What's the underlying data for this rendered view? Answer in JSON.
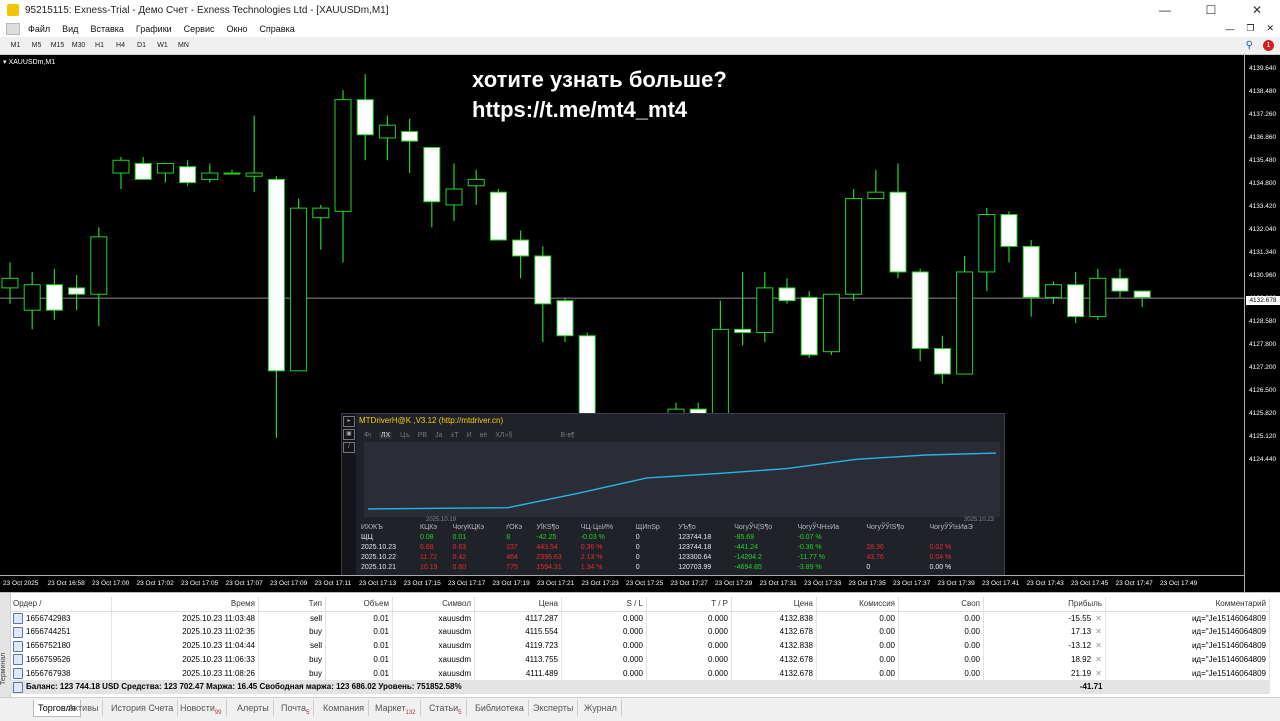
{
  "window": {
    "title": "95215115: Exness-Trial - Демо Счет - Exness Technologies Ltd - [XAUUSDm,M1]",
    "minimize_icon": "minimize-icon",
    "maximize_icon": "maximize-icon",
    "close_icon": "close-icon"
  },
  "menu": {
    "items": [
      "Файл",
      "Вид",
      "Вставка",
      "Графики",
      "Сервис",
      "Окно",
      "Справка"
    ]
  },
  "toolbar": {
    "timeframes": [
      "M1",
      "M5",
      "M15",
      "M30",
      "H1",
      "H4",
      "D1",
      "W1",
      "MN"
    ],
    "notification_count": "1"
  },
  "chart": {
    "tab_label": "XAUUSDm,M1",
    "watermark_line1": "хотите узнать больше?",
    "watermark_line2": "https://t.me/mt4_mt4",
    "current_price": "4132.678",
    "colors": {
      "background": "#000000",
      "candle_border": "#22d422",
      "candle_bull": "#000000",
      "candle_bear": "#ffffff"
    }
  },
  "chart_data": {
    "type": "candlestick",
    "symbol": "XAUUSDm",
    "timeframe": "M1",
    "y_ticks": [
      "4139.640",
      "4138.480",
      "4137.260",
      "4136.860",
      "4135.480",
      "4134.800",
      "4133.420",
      "4132.040",
      "4131.340",
      "4130.960",
      "4129.960",
      "4128.580",
      "4127.800",
      "4127.200",
      "4126.500",
      "4125.820",
      "4125.120",
      "4124.440"
    ],
    "x_ticks": [
      "23 Oct 2025",
      "23 Oct 16:58",
      "23 Oct 17:00",
      "23 Oct 17:02",
      "23 Oct 17:05",
      "23 Oct 17:07",
      "23 Oct 17:09",
      "23 Oct 17:11",
      "23 Oct 17:13",
      "23 Oct 17:15",
      "23 Oct 17:17",
      "23 Oct 17:19",
      "23 Oct 17:21",
      "23 Oct 17:23",
      "23 Oct 17:25",
      "23 Oct 17:27",
      "23 Oct 17:29",
      "23 Oct 17:31",
      "23 Oct 17:33",
      "23 Oct 17:35",
      "23 Oct 17:37",
      "23 Oct 17:39",
      "23 Oct 17:41",
      "23 Oct 17:43",
      "23 Oct 17:45",
      "23 Oct 17:47",
      "23 Oct 17:49"
    ],
    "candles": [
      {
        "o": 4133.0,
        "h": 4133.8,
        "l": 4132.5,
        "c": 4133.3
      },
      {
        "o": 4132.3,
        "h": 4133.5,
        "l": 4131.7,
        "c": 4133.1
      },
      {
        "o": 4133.1,
        "h": 4133.6,
        "l": 4132.0,
        "c": 4132.3
      },
      {
        "o": 4133.0,
        "h": 4133.4,
        "l": 4132.3,
        "c": 4132.8
      },
      {
        "o": 4132.8,
        "h": 4134.9,
        "l": 4131.8,
        "c": 4134.6
      },
      {
        "o": 4136.6,
        "h": 4137.1,
        "l": 4136.1,
        "c": 4137.0
      },
      {
        "o": 4136.9,
        "h": 4137.1,
        "l": 4136.4,
        "c": 4136.4
      },
      {
        "o": 4136.6,
        "h": 4136.9,
        "l": 4136.3,
        "c": 4136.9
      },
      {
        "o": 4136.8,
        "h": 4137.0,
        "l": 4136.2,
        "c": 4136.3
      },
      {
        "o": 4136.4,
        "h": 4136.9,
        "l": 4136.3,
        "c": 4136.6
      },
      {
        "o": 4136.6,
        "h": 4136.7,
        "l": 4136.6,
        "c": 4136.6
      },
      {
        "o": 4136.5,
        "h": 4138.4,
        "l": 4136.0,
        "c": 4136.6
      },
      {
        "o": 4136.4,
        "h": 4136.5,
        "l": 4128.3,
        "c": 4130.4
      },
      {
        "o": 4130.4,
        "h": 4135.8,
        "l": 4130.4,
        "c": 4135.5
      },
      {
        "o": 4135.2,
        "h": 4135.6,
        "l": 4134.2,
        "c": 4135.5
      },
      {
        "o": 4135.4,
        "h": 4139.2,
        "l": 4133.8,
        "c": 4138.9
      },
      {
        "o": 4138.9,
        "h": 4139.7,
        "l": 4137.0,
        "c": 4137.8
      },
      {
        "o": 4137.7,
        "h": 4138.4,
        "l": 4137.0,
        "c": 4138.1
      },
      {
        "o": 4137.9,
        "h": 4138.3,
        "l": 4136.6,
        "c": 4137.6
      },
      {
        "o": 4137.4,
        "h": 4137.4,
        "l": 4134.9,
        "c": 4135.7
      },
      {
        "o": 4135.6,
        "h": 4136.9,
        "l": 4135.1,
        "c": 4136.1
      },
      {
        "o": 4136.2,
        "h": 4136.7,
        "l": 4135.6,
        "c": 4136.4
      },
      {
        "o": 4136.0,
        "h": 4136.1,
        "l": 4134.5,
        "c": 4134.5
      },
      {
        "o": 4134.5,
        "h": 4134.8,
        "l": 4133.3,
        "c": 4134.0
      },
      {
        "o": 4134.0,
        "h": 4134.3,
        "l": 4131.3,
        "c": 4132.5
      },
      {
        "o": 4132.6,
        "h": 4132.7,
        "l": 4131.3,
        "c": 4131.5
      },
      {
        "o": 4131.5,
        "h": 4131.6,
        "l": 4127.8,
        "c": 4128.6
      },
      {
        "o": 4128.6,
        "h": 4128.7,
        "l": 4128.4,
        "c": 4128.6
      },
      {
        "o": 4128.6,
        "h": 4128.7,
        "l": 4128.4,
        "c": 4128.6
      },
      {
        "o": 4128.6,
        "h": 4128.8,
        "l": 4128.5,
        "c": 4128.7
      },
      {
        "o": 4128.7,
        "h": 4129.4,
        "l": 4128.4,
        "c": 4129.2
      },
      {
        "o": 4129.2,
        "h": 4129.4,
        "l": 4128.5,
        "c": 4128.7
      },
      {
        "o": 4128.5,
        "h": 4132.6,
        "l": 4128.3,
        "c": 4131.7
      },
      {
        "o": 4131.7,
        "h": 4133.5,
        "l": 4131.2,
        "c": 4131.6
      },
      {
        "o": 4131.6,
        "h": 4133.5,
        "l": 4131.3,
        "c": 4133.0
      },
      {
        "o": 4133.0,
        "h": 4133.3,
        "l": 4132.5,
        "c": 4132.6
      },
      {
        "o": 4132.7,
        "h": 4132.9,
        "l": 4130.8,
        "c": 4130.9
      },
      {
        "o": 4131.0,
        "h": 4132.8,
        "l": 4130.9,
        "c": 4132.8
      },
      {
        "o": 4132.8,
        "h": 4136.1,
        "l": 4132.6,
        "c": 4135.8
      },
      {
        "o": 4135.8,
        "h": 4136.7,
        "l": 4135.8,
        "c": 4136.0
      },
      {
        "o": 4136.0,
        "h": 4136.9,
        "l": 4133.3,
        "c": 4133.5
      },
      {
        "o": 4133.5,
        "h": 4133.6,
        "l": 4130.7,
        "c": 4131.1
      },
      {
        "o": 4131.1,
        "h": 4131.5,
        "l": 4130.0,
        "c": 4130.3
      },
      {
        "o": 4130.3,
        "h": 4134.0,
        "l": 4130.3,
        "c": 4133.5
      },
      {
        "o": 4133.5,
        "h": 4135.5,
        "l": 4132.9,
        "c": 4135.3
      },
      {
        "o": 4135.3,
        "h": 4135.4,
        "l": 4133.8,
        "c": 4134.3
      },
      {
        "o": 4134.3,
        "h": 4134.5,
        "l": 4132.1,
        "c": 4132.7
      },
      {
        "o": 4132.7,
        "h": 4133.2,
        "l": 4132.5,
        "c": 4133.1
      },
      {
        "o": 4133.1,
        "h": 4133.5,
        "l": 4131.9,
        "c": 4132.1
      },
      {
        "o": 4132.1,
        "h": 4133.6,
        "l": 4132.0,
        "c": 4133.3
      },
      {
        "o": 4133.3,
        "h": 4133.6,
        "l": 4132.7,
        "c": 4132.9
      },
      {
        "o": 4132.9,
        "h": 4132.9,
        "l": 4132.4,
        "c": 4132.7
      }
    ]
  },
  "ea_panel": {
    "title": "MTDriverH@K ,V3.12 (http://mtdriver.cn)",
    "tabs": [
      "Фі",
      "ЛХ",
      "Цъ",
      "РВ",
      "Ја",
      "±Т",
      "И",
      "вё",
      "ХЛ»§",
      "В-в¶"
    ],
    "active_tab": "ЛХ",
    "graph_start_label": "2025.10.19",
    "graph_end_label": "2025.10.23",
    "equity_curve": [
      0.05,
      0.06,
      0.07,
      0.3,
      0.55,
      0.62,
      0.7,
      0.85,
      0.92,
      0.95
    ],
    "headers": [
      "ИХЖЪ",
      "КЦКэ",
      "ЧогуКЦКэ",
      "ґОКэ",
      "УЇКЅ¶о",
      "ЧЦ·Ц±И%",
      "ЩИnЅр",
      "УЪ¶о",
      "ЧогуЎЧ¦Ѕ¶о",
      "ЧогуЎЧН±Иа",
      "ЧогуЎЎїЅ¶о",
      "ЧогуЎЎї±ИаЭ"
    ],
    "rows": [
      {
        "date": "ЩЦ",
        "c1": "0.08",
        "c2": "0.01",
        "c3": "8",
        "c4": "-42.25",
        "c5": "-0.03 %",
        "c6": "0",
        "c7": "123744.18",
        "c8": "-85.69",
        "c9": "-0.07 %",
        "c10": "",
        "c11": "",
        "tone": "green"
      },
      {
        "date": "2025.10.23",
        "c1": "6.68",
        "c2": "0.63",
        "c3": "237",
        "c4": "443.54",
        "c5": "0.36 %",
        "c6": "0",
        "c7": "123744.18",
        "c8": "-441.24",
        "c9": "-0.36 %",
        "c10": "28.36",
        "c11": "0.02 %",
        "tone": "red"
      },
      {
        "date": "2025.10.22",
        "c1": "11.72",
        "c2": "0.42",
        "c3": "464",
        "c4": "2396.63",
        "c5": "2.13 %",
        "c6": "0",
        "c7": "123300.64",
        "c8": "-14204.2",
        "c9": "-11.77 %",
        "c10": "43.76",
        "c11": "0.04 %",
        "tone": "red"
      },
      {
        "date": "2025.10.21",
        "c1": "10.19",
        "c2": "0.60",
        "c3": "775",
        "c4": "1594.31",
        "c5": "1.34 %",
        "c6": "0",
        "c7": "120703.99",
        "c8": "-4694.85",
        "c9": "-3.89 %",
        "c10": "0",
        "c11": "0.00 %",
        "tone": "red"
      }
    ]
  },
  "terminal": {
    "side_label": "Терминал",
    "columns": [
      "Ордер",
      "/",
      "Время",
      "Тип",
      "Объем",
      "Символ",
      "Цена",
      "S / L",
      "T / P",
      "Цена",
      "Комиссия",
      "Своп",
      "Прибыль",
      "Комментарий"
    ],
    "orders": [
      {
        "id": "1656742983",
        "time": "2025.10.23 11:03:48",
        "type": "sell",
        "volume": "0.01",
        "symbol": "xauusdm",
        "open_price": "4117.287",
        "sl": "0.000",
        "tp": "0.000",
        "price": "4132.838",
        "commission": "0.00",
        "swap": "0.00",
        "profit": "-15.55",
        "comment": "ид=\"Je15146064809"
      },
      {
        "id": "1656744251",
        "time": "2025.10.23 11:02:35",
        "type": "buy",
        "volume": "0.01",
        "symbol": "xauusdm",
        "open_price": "4115.554",
        "sl": "0.000",
        "tp": "0.000",
        "price": "4132.678",
        "commission": "0.00",
        "swap": "0.00",
        "profit": "17.13",
        "comment": "ид=\"Je15146064809"
      },
      {
        "id": "1656752180",
        "time": "2025.10.23 11:04:44",
        "type": "sell",
        "volume": "0.01",
        "symbol": "xauusdm",
        "open_price": "4119.723",
        "sl": "0.000",
        "tp": "0.000",
        "price": "4132.838",
        "commission": "0.00",
        "swap": "0.00",
        "profit": "-13.12",
        "comment": "ид=\"Je15146064809"
      },
      {
        "id": "1656759526",
        "time": "2025.10.23 11:06:33",
        "type": "buy",
        "volume": "0.01",
        "symbol": "xauusdm",
        "open_price": "4113.755",
        "sl": "0.000",
        "tp": "0.000",
        "price": "4132.678",
        "commission": "0.00",
        "swap": "0.00",
        "profit": "18.92",
        "comment": "ид=\"Je15146064809"
      },
      {
        "id": "1656767938",
        "time": "2025.10.23 11:08:26",
        "type": "buy",
        "volume": "0.01",
        "symbol": "xauusdm",
        "open_price": "4111.489",
        "sl": "0.000",
        "tp": "0.000",
        "price": "4132.678",
        "commission": "0.00",
        "swap": "0.00",
        "profit": "21.19",
        "comment": "ид=\"Je15146064809"
      }
    ],
    "summary": "Баланс: 123 744.18 USD  Средства: 123 702.47  Маржа: 16.45  Свободная маржа: 123 686.02  Уровень: 751852.58%",
    "summary_profit": "-41.71"
  },
  "bottom_tabs": [
    {
      "label": "Торговля",
      "badge": "",
      "active": true
    },
    {
      "label": "Активы",
      "badge": "",
      "active": false
    },
    {
      "label": "История Счета",
      "badge": "",
      "active": false
    },
    {
      "label": "Новости",
      "badge": "99",
      "active": false
    },
    {
      "label": "Алерты",
      "badge": "",
      "active": false
    },
    {
      "label": "Почта",
      "badge": "5",
      "active": false
    },
    {
      "label": "Компания",
      "badge": "",
      "active": false
    },
    {
      "label": "Маркет",
      "badge": "132",
      "active": false
    },
    {
      "label": "Статьи",
      "badge": "5",
      "active": false
    },
    {
      "label": "Библиотека",
      "badge": "",
      "active": false
    },
    {
      "label": "Эксперты",
      "badge": "",
      "active": false
    },
    {
      "label": "Журнал",
      "badge": "",
      "active": false
    }
  ]
}
